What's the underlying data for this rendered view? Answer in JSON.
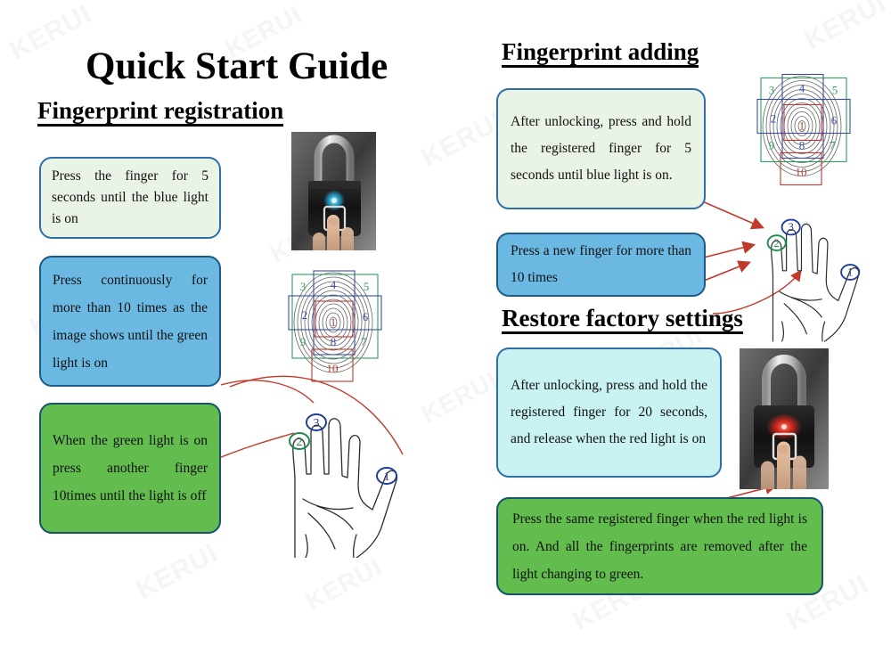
{
  "document": {
    "title": "Quick Start Guide",
    "brand_watermark": "KERUI"
  },
  "sections": [
    {
      "id": "fingerprint-registration",
      "heading": "Fingerprint registration"
    },
    {
      "id": "fingerprint-adding",
      "heading": "Fingerprint adding"
    },
    {
      "id": "restore-factory-settings",
      "heading": "Restore factory settings"
    }
  ],
  "callouts": {
    "reg_step1": "Press the finger for 5 seconds until the blue light is on",
    "reg_step2": "Press continuously for more than 10 times as the image shows until the green light is on",
    "reg_step3": "When the green light is on press another finger 10times until the light is off",
    "add_step1": "After unlocking, press and hold the registered finger for 5 seconds until blue light is on.",
    "add_step2": "Press a new finger for more than 10 times",
    "restore_step1": "After unlocking, press and hold the registered finger for 20 seconds, and release when the red light is on",
    "restore_step2": "Press the same registered finger when the red light is on. And all the fingerprints are removed after the light changing to green."
  },
  "fingerprint_diagram": {
    "caption": "fingerprint roll positions",
    "zones": [
      {
        "n": "1",
        "color": "#c0392b"
      },
      {
        "n": "2",
        "color": "#3b4fa0"
      },
      {
        "n": "3",
        "color": "#2f9e5e"
      },
      {
        "n": "4",
        "color": "#3b4fa0"
      },
      {
        "n": "5",
        "color": "#2f9e5e"
      },
      {
        "n": "6",
        "color": "#3b4fa0"
      },
      {
        "n": "7",
        "color": "#2f9e5e"
      },
      {
        "n": "8",
        "color": "#3b4fa0"
      },
      {
        "n": "9",
        "color": "#2f9e5e"
      },
      {
        "n": "10",
        "color": "#c0392b"
      }
    ]
  },
  "hand_diagram": {
    "caption": "hand with numbered fingers",
    "markers": [
      {
        "n": "1",
        "color": "#1f3d99",
        "finger": "thumb"
      },
      {
        "n": "2",
        "color": "#1e8b4d",
        "finger": "little-finger"
      },
      {
        "n": "3",
        "color": "#1f3d99",
        "finger": "ring-finger"
      }
    ]
  },
  "lock_photos": {
    "blue_led": {
      "caption": "smart padlock, finger on sensor, blue LED",
      "led_color": "#2aa8d8"
    },
    "red_led": {
      "caption": "smart padlock, finger on sensor, red LED",
      "led_color": "#e02b1d"
    }
  },
  "colors": {
    "mint_box": "#e9f3e6",
    "blue_box": "#6bb9e2",
    "green_box": "#62bc4e",
    "cyan_box": "#c9f2f2",
    "box_border": "#2e6ea8",
    "arrow": "#c0392b"
  }
}
